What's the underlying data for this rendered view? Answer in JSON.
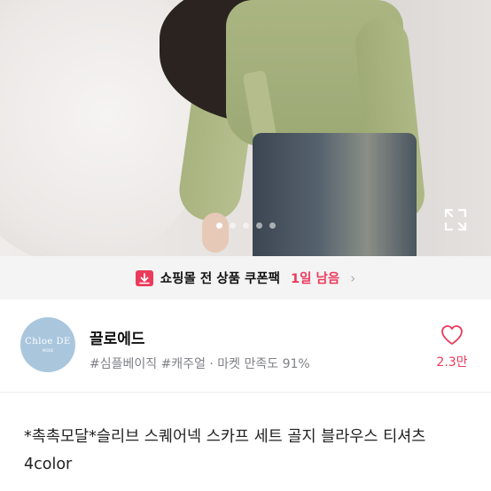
{
  "hero": {
    "image_alt": "product photo",
    "dot_count": 5,
    "active_dot": 0,
    "expand_icon": "expand-icon"
  },
  "coupon": {
    "icon": "coupon-icon",
    "text": "쇼핑몰 전 상품 쿠폰팩",
    "remaining": "1일 남음",
    "chevron": "chevron-right-icon",
    "accent": "#ec3a5b"
  },
  "shop": {
    "avatar_text": "Chloe DE",
    "avatar_subtext": "MODE",
    "name": "끌로에드",
    "tags": "#심플베이직 #캐주얼 · 마켓 만족도 91%",
    "like_icon": "heart-icon",
    "like_count": "2.3만"
  },
  "product": {
    "title": "*촉촉모달*슬리브 스퀘어넥 스카프 세트 골지 블라우스 티셔츠 4color"
  }
}
